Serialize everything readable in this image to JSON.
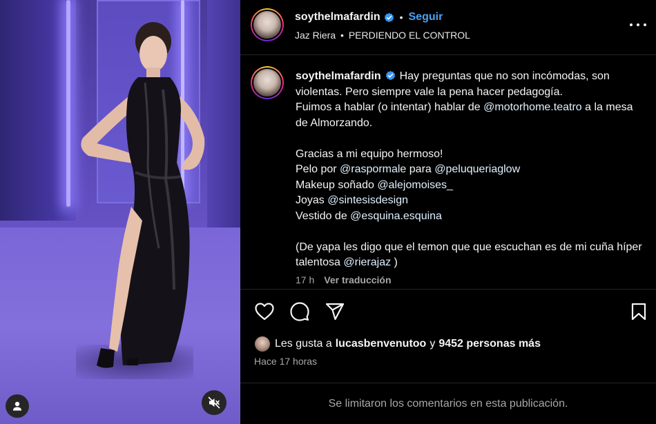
{
  "header": {
    "username": "soythelmafardin",
    "separator": "•",
    "follow_label": "Seguir",
    "audio_artist": "Jaz Riera",
    "audio_separator": "•",
    "audio_track": "PERDIENDO EL CONTROL"
  },
  "caption": {
    "username": "soythelmafardin",
    "lines": {
      "l1": "Hay preguntas que no son incómodas, son violentas. Pero siempre vale la pena hacer pedagogía.",
      "l2a": "Fuimos a hablar (o intentar) hablar de ",
      "l2_mention": "@motorhome.teatro",
      "l2b": " a la mesa de Almorzando.",
      "l3": "Gracias a mi equipo hermoso!",
      "l4a": "Pelo por ",
      "l4_mention1": "@raspormale",
      "l4b": " para ",
      "l4_mention2": "@peluqueriaglow",
      "l5a": "Makeup soñado ",
      "l5_mention": "@alejomoises_",
      "l6a": "Joyas ",
      "l6_mention": "@sintesisdesign",
      "l7a": "Vestido de ",
      "l7_mention": "@esquina.esquina",
      "l8a": "(De yapa les digo que el temon que que escuchan es de mi cuña híper talentosa ",
      "l8_mention": "@rierajaz",
      "l8b": " )"
    },
    "age": "17 h",
    "translate_label": "Ver traducción"
  },
  "actions": {
    "like_icon": "heart-icon",
    "comment_icon": "comment-icon",
    "share_icon": "paper-plane-icon",
    "save_icon": "bookmark-icon"
  },
  "likes": {
    "prefix": "Les gusta a",
    "user": "lucasbenvenutoo",
    "conj": "y",
    "count": "9452 personas más"
  },
  "posted": "Hace 17 horas",
  "comments_notice": "Se limitaron los comentarios en esta publicación.",
  "colors": {
    "follow": "#4aa3f5",
    "verified": "#3897f0",
    "muted_text": "#a8a8a8",
    "divider": "#262626"
  }
}
